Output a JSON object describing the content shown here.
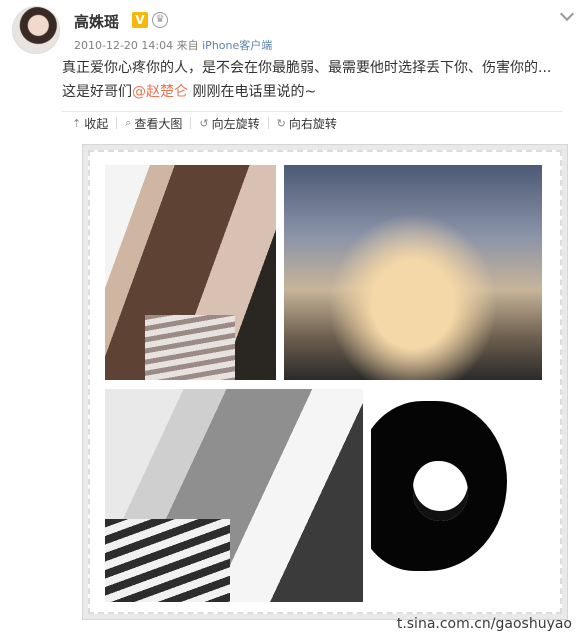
{
  "post": {
    "author": "高姝瑶",
    "badges": {
      "verified": "V",
      "crown": "♛"
    },
    "date": "2010-12-20 14:04",
    "from": "来自",
    "source": "iPhone客户端",
    "text_line1": "真正爱你心疼你的人，是不会在你最脆弱、最需要他时选择丢下你、伤害你的...",
    "text_line2_before": "这是好哥们",
    "mention": "@赵楚仑",
    "text_line2_after": " 刚刚在电话里说的~"
  },
  "toolbar": {
    "collapse": "收起",
    "view_large": "查看大图",
    "rotate_left": "向左旋转",
    "rotate_right": "向右旋转"
  },
  "watermark": "t.sina.com.cn/gaoshuyao",
  "icons": [
    "avatar",
    "verified-icon",
    "crown-icon",
    "chevron-down-icon",
    "collapse-icon",
    "zoom-icon",
    "rotate-left-icon",
    "rotate-right-icon"
  ]
}
